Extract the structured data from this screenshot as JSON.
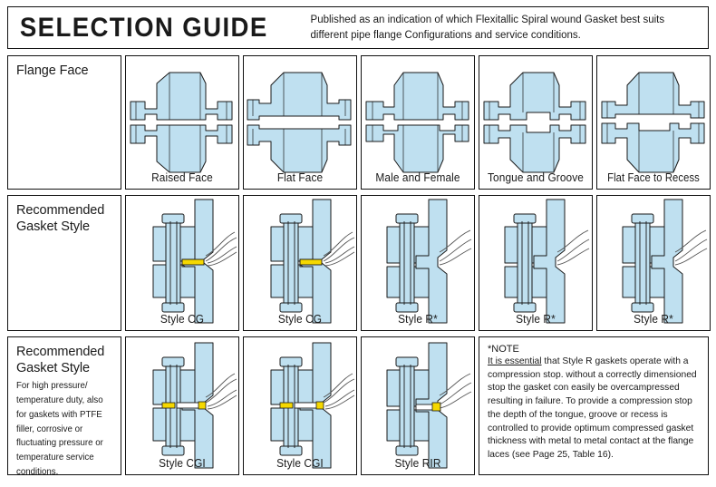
{
  "header": {
    "title": "SELECTION GUIDE",
    "subtitle": "Published as an indication of which Flexitallic Spiral wound Gasket best suits different pipe flange Configurations and service conditions."
  },
  "rows": [
    {
      "head": {
        "title": "Flange Face",
        "body": ""
      },
      "cells": [
        {
          "label": "Raised Face",
          "diagram": "flange-raised-face"
        },
        {
          "label": "Flat Face",
          "diagram": "flange-flat-face"
        },
        {
          "label": "Male and Female",
          "diagram": "flange-male-and-female"
        },
        {
          "label": "Tongue and Groove",
          "diagram": "flange-tongue-and-groove"
        },
        {
          "label": "Flat Face to Recess",
          "diagram": "flange-flat-face-to-recess"
        }
      ]
    },
    {
      "head": {
        "title": "Recommended Gasket Style",
        "body": ""
      },
      "cells": [
        {
          "label": "Style CG",
          "diagram": "joint-style-cg"
        },
        {
          "label": "Style CG",
          "diagram": "joint-style-cg"
        },
        {
          "label": "Style R*",
          "diagram": "joint-style-r"
        },
        {
          "label": "Style R*",
          "diagram": "joint-style-r"
        },
        {
          "label": "Style R*",
          "diagram": "joint-style-r"
        }
      ]
    },
    {
      "head": {
        "title": "Recommended Gasket Style",
        "body": "For high pressure/ temperature duty, also for gaskets with PTFE filler, corrosive or fluctuating pressure or temperature service conditions."
      },
      "cells": [
        {
          "label": "Style CGI",
          "diagram": "joint-style-cgi"
        },
        {
          "label": "Style CGI",
          "diagram": "joint-style-cgi"
        },
        {
          "label": "Style RIR",
          "diagram": "joint-style-rir"
        }
      ]
    }
  ],
  "note": {
    "title": "*NOTE",
    "emphasis": "It is essential",
    "text": " that Style R gaskets operate with a compression stop. without a correctly dimensioned stop the gasket con easily be overcampressed resulting in failure. To provide a compression stop the depth of the tongue, groove or recess is controlled to provide optimum compressed gasket thickness with metal to metal contact at the flange laces (see Page 25, Table 16)."
  },
  "colors": {
    "metal_fill": "#bfe0f0",
    "metal_fill_light": "#d4ebf6",
    "outline": "#1a1a1a",
    "gasket": "#f5d800",
    "border": "#111111"
  }
}
